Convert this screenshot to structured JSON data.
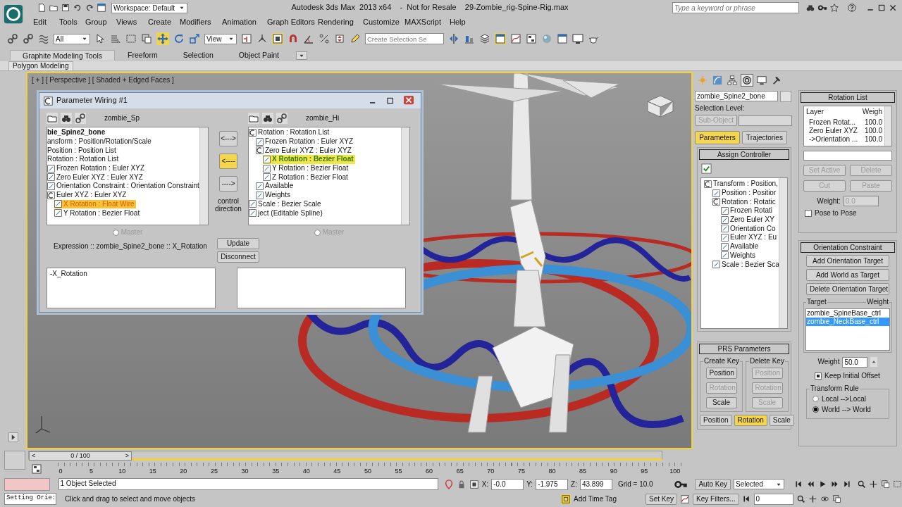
{
  "window": {
    "title": "Autodesk 3ds Max  2013 x64    -  Not for Resale    29-Zombie_rig-Spine-Rig.max",
    "workspace": "Workspace: Default",
    "search": {
      "placeholder": "Type a keyword or phrase"
    }
  },
  "menu": [
    "Edit",
    "Tools",
    "Group",
    "Views",
    "Create",
    "Modifiers",
    "Animation",
    "Graph Editors",
    "Rendering",
    "Customize",
    "MAXScript",
    "Help"
  ],
  "toolbar": {
    "selection_filter": "All",
    "reference_coordinates": "View",
    "named_selection": {
      "placeholder": "Create Selection Se"
    }
  },
  "ribbon": {
    "tabs": [
      {
        "label": "Graphite Modeling Tools",
        "selected": true
      },
      {
        "label": "Freeform",
        "selected": false
      },
      {
        "label": "Selection",
        "selected": false
      },
      {
        "label": "Object Paint",
        "selected": false
      }
    ],
    "panel": "Polygon Modeling"
  },
  "viewport": {
    "label": "[ + ] [ Perspective ] [ Shaded + Edged Faces ]"
  },
  "parameter_wiring": {
    "title": "Parameter Wiring #1",
    "left": {
      "object": "zombie_Sp",
      "tree": [
        {
          "label": "bie_Spine2_bone",
          "selected": false,
          "children": [
            {
              "label": "ansform : Position/Rotation/Scale",
              "selected": false,
              "children": [
                {
                  "label": "Position : Position List",
                  "selected": false
                },
                {
                  "label": "Rotation : Rotation List",
                  "selected": false,
                  "children": [
                    {
                      "label": "Frozen Rotation : Euler XYZ",
                      "selected": false
                    },
                    {
                      "label": "Zero Euler XYZ : Euler XYZ",
                      "selected": false
                    },
                    {
                      "label": "Orientation Constraint : Orientation Constraint",
                      "selected": false
                    },
                    {
                      "label": "Euler XYZ : Euler XYZ",
                      "selected": false,
                      "children": [
                        {
                          "label": "X Rotation : Float Wire",
                          "selected": true
                        },
                        {
                          "label": "Y Rotation : Bezier Float",
                          "selected": false
                        }
                      ]
                    }
                  ]
                }
              ]
            }
          ]
        }
      ],
      "master": {
        "label": "Master",
        "disabled": true
      },
      "expression": "-X_Rotation"
    },
    "right": {
      "object": "zombie_Hi",
      "tree": [
        {
          "label": "Rotation : Rotation List",
          "selected": false,
          "children": [
            {
              "label": "Frozen Rotation : Euler XYZ",
              "selected": false
            },
            {
              "label": "Zero Euler XYZ : Euler XYZ",
              "selected": false,
              "children": [
                {
                  "label": "X Rotation : Bezier Float",
                  "selected": true
                },
                {
                  "label": "Y Rotation : Bezier Float",
                  "selected": false
                },
                {
                  "label": "Z Rotation : Bezier Float",
                  "selected": false
                }
              ]
            },
            {
              "label": "Available",
              "selected": false
            },
            {
              "label": "Weights",
              "selected": false
            }
          ]
        },
        {
          "label": "Scale : Bezier Scale",
          "selected": false
        },
        {
          "label": "ject (Editable Spline)",
          "selected": false
        }
      ],
      "master": {
        "label": "Master",
        "disabled": true
      }
    },
    "directions": [
      {
        "label": "<--->",
        "selected": false
      },
      {
        "label": "<----",
        "selected": true
      },
      {
        "label": "---->",
        "selected": false
      }
    ],
    "direction_caption": "control direction",
    "buttons": [
      "Update",
      "Disconnect"
    ],
    "expression_label": "Expression :: zombie_Spine2_bone :: X_Rotation"
  },
  "command_panel": {
    "tabs": [
      {
        "kind": "create",
        "selected": false
      },
      {
        "kind": "modify",
        "selected": false
      },
      {
        "kind": "hierarchy",
        "selected": false
      },
      {
        "kind": "motion",
        "selected": true
      },
      {
        "kind": "display",
        "selected": false
      },
      {
        "kind": "utilities",
        "selected": false
      }
    ],
    "object_name": "zombie_Spine2_bone",
    "selection_level_label": "Selection Level:",
    "sub_object": {
      "label": "Sub-Object",
      "disabled": true
    },
    "modes": [
      {
        "label": "Parameters",
        "selected": true
      },
      {
        "label": "Trajectories",
        "selected": false
      }
    ],
    "assign_controller": {
      "title": "Assign Controller",
      "tree": [
        {
          "label": "Transform : Position,",
          "children": [
            {
              "label": "Position : Positior"
            },
            {
              "label": "Rotation : Rotatic",
              "children": [
                {
                  "label": "Frozen Rotati"
                },
                {
                  "label": "Zero Euler XY"
                },
                {
                  "label": "Orientation Co"
                },
                {
                  "label": "Euler XYZ : Eu"
                },
                {
                  "label": "Available"
                },
                {
                  "label": "Weights"
                }
              ]
            },
            {
              "label": "Scale : Bezier Sca"
            }
          ]
        }
      ]
    },
    "prs": {
      "title": "PRS Parameters",
      "create_key": {
        "label": "Create Key",
        "buttons": [
          {
            "label": "Position",
            "disabled": false
          },
          {
            "label": "Rotation",
            "disabled": true
          },
          {
            "label": "Scale",
            "disabled": false
          }
        ]
      },
      "delete_key": {
        "label": "Delete Key",
        "buttons": [
          {
            "label": "Position",
            "disabled": true
          },
          {
            "label": "Rotation",
            "disabled": true
          },
          {
            "label": "Scale",
            "disabled": true
          }
        ]
      },
      "tabs": [
        {
          "label": "Position",
          "selected": false
        },
        {
          "label": "Rotation",
          "selected": true
        },
        {
          "label": "Scale",
          "selected": false
        }
      ]
    },
    "rotation_list": {
      "title": "Rotation List",
      "columns": [
        "Layer",
        "Weigh"
      ],
      "rows": [
        [
          "Frozen Rotat...",
          "100.0"
        ],
        [
          "Zero Euler XYZ",
          "100.0"
        ],
        [
          "->Orientation ...",
          "100.0"
        ]
      ],
      "buttons": [
        {
          "label": "Set Active",
          "disabled": true
        },
        {
          "label": "Delete",
          "disabled": true
        },
        {
          "label": "Cut",
          "disabled": true
        },
        {
          "label": "Paste",
          "disabled": true
        }
      ],
      "weight": {
        "label": "Weight:",
        "value": "0.0",
        "disabled": true
      },
      "pose_to_pose": {
        "label": "Pose to Pose",
        "checked": false
      }
    },
    "orientation_constraint": {
      "title": "Orientation Constraint",
      "buttons": [
        "Add Orientation Target",
        "Add World as Target",
        "Delete Orientation Target"
      ],
      "columns": [
        "Target",
        "Weight"
      ],
      "targets": [
        {
          "label": "zombie_SpineBase_ctrl",
          "selected": false
        },
        {
          "label": "zombie_NeckBase_ctrl",
          "selected": true
        }
      ],
      "weight": {
        "label": "Weight",
        "value": "50.0"
      },
      "keep_initial_offset": {
        "label": "Keep Initial Offset",
        "checked": true
      },
      "transform_rule": {
        "label": "Transform Rule",
        "options": [
          {
            "label": "Local -->Local",
            "selected": false
          },
          {
            "label": "World --> World",
            "selected": true
          }
        ]
      }
    }
  },
  "time_slider": {
    "label": "0 / 100",
    "prev": "<",
    "next": ">",
    "ticks": [
      "0",
      "5",
      "10",
      "15",
      "20",
      "25",
      "30",
      "35",
      "40",
      "45",
      "50",
      "55",
      "60",
      "65",
      "70",
      "75",
      "80",
      "85",
      "90",
      "95",
      "100"
    ]
  },
  "status_bar": {
    "listener": "Setting Orie:",
    "selection": "1 Object Selected",
    "prompt": "Click and drag to select and move objects",
    "x": {
      "label": "X:",
      "value": "-0.0"
    },
    "y": {
      "label": "Y:",
      "value": "-1.975"
    },
    "z": {
      "label": "Z:",
      "value": "43.899"
    },
    "grid": "Grid = 10.0",
    "add_time_tag": "Add Time Tag",
    "auto_key": "Auto Key",
    "key_set": "Selected",
    "set_key": "Set Key",
    "key_filters": "Key Filters...",
    "frame": "0"
  }
}
